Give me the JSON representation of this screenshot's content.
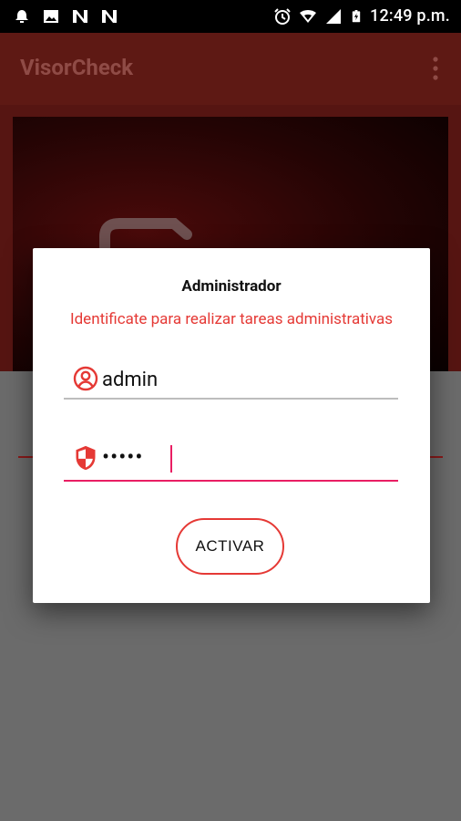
{
  "status_bar": {
    "left_icons": [
      "alarm-bell-icon",
      "image-icon",
      "n-app-icon",
      "n-app-icon"
    ],
    "right_icons": [
      "alarm-clock-icon",
      "wifi-icon",
      "signal-icon",
      "battery-charging-icon"
    ],
    "time": "12:49 p.m."
  },
  "app_bar": {
    "title": "VisorCheck",
    "overflow_icon": "more-vert-icon"
  },
  "dialog": {
    "title": "Administrador",
    "message": "Identificate para realizar tareas administrativas",
    "username": {
      "value": "admin",
      "icon": "account-circle-icon"
    },
    "password": {
      "value": "•••••",
      "icon": "shield-icon"
    },
    "button_label": "ACTIVAR"
  },
  "colors": {
    "accent": "#e53935",
    "focus": "#e91e63",
    "app_bar": "#5e1914"
  }
}
